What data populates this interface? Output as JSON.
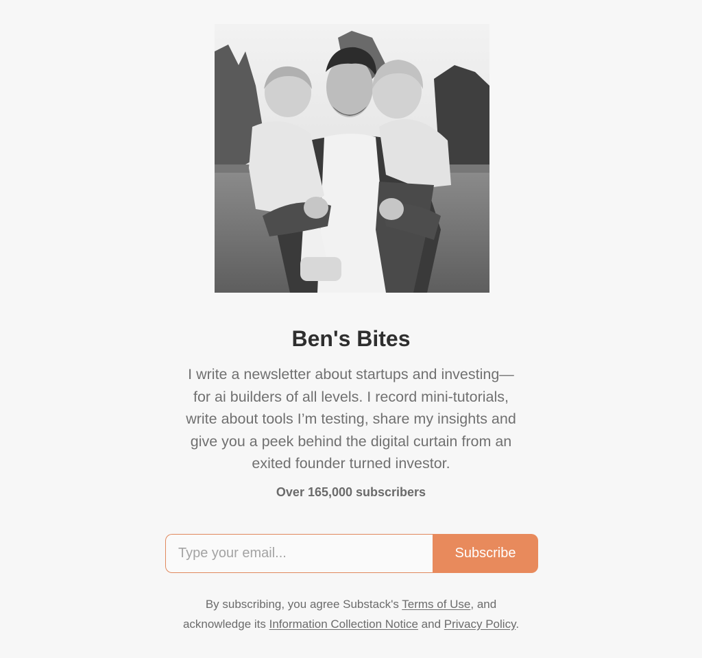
{
  "publication": {
    "name": "Ben's Bites",
    "description": "I write a newsletter about startups and investing—for ai builders of all levels. I record mini-tutorials, write about tools I’m testing, share my insights and give you a peek behind the digital curtain from an exited founder turned investor.",
    "subscriber_count": "Over 165,000 subscribers"
  },
  "subscribe": {
    "email_placeholder": "Type your email...",
    "button_label": "Subscribe"
  },
  "legal": {
    "prefix": "By subscribing, you agree Substack's ",
    "terms_link": "Terms of Use",
    "middle": ", and acknowledge its ",
    "notice_link": "Information Collection Notice",
    "and_text": " and ",
    "privacy_link": "Privacy Policy",
    "suffix": "."
  },
  "colors": {
    "accent": "#e88a5c",
    "background": "#f7f7f7"
  }
}
